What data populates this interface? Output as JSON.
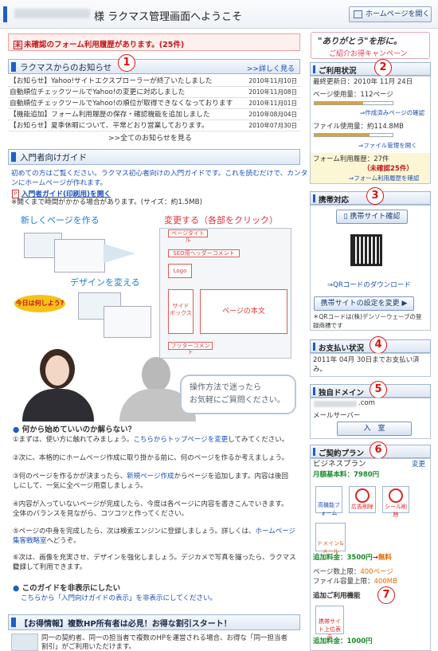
{
  "header": {
    "title": "様 ラクマス管理画面へようこそ",
    "home_button": "ホームページを開く"
  },
  "notice": {
    "mark": "未",
    "text": "未確認のフォーム利用履歴があります。(25件)"
  },
  "news": {
    "title": "ラクマスからのお知らせ",
    "more": ">>詳しく見る",
    "badge": "1",
    "items": [
      {
        "text": "【お知らせ】Yahoo!サイトエクスプローラーが終了いたしました",
        "date": "2010年11月10日"
      },
      {
        "text": "自動順位チェックツールでYahoo!の変更に対応しました",
        "date": "2010年11月08日"
      },
      {
        "text": "自動順位チェックツールでYahoo!の順位が取得できなくなっております",
        "date": "2010年11月01日"
      },
      {
        "text": "【機能追加】フォーム利用履歴の保存・確認機能を追加しました",
        "date": "2010年08月04日"
      },
      {
        "text": "【お知らせ】夏季休暇について、平常どおり営業しております。",
        "date": "2010年07月30日"
      }
    ],
    "all_link": ">>全てのお知らせを見る"
  },
  "guide": {
    "title": "入門者向けガイド",
    "intro1": "初めての方はご覧ください。ラクマス初心者向けの入門ガイドです。これを読むだけで、カンタ",
    "intro2": "ンにホームページが作れます。",
    "pdf_link": "入門者ガイド(印刷用)を開く",
    "pdf_note": "※開くまで時間がかかる場合があります。(サイズ：約1.5MB)",
    "illust": {
      "new_page": "新しくページを作る",
      "change": "変更する（各部をクリック）",
      "design": "デザインを変える",
      "today": "今日は何しよう?",
      "page_title": "ページタイトル",
      "seo_header": "SEO用ヘッダーコメント",
      "logo": "Logo",
      "sidebox": "サイド\nボックス",
      "body": "ページの本文",
      "footer": "フッターコメント",
      "balloon1": "操作方法で迷ったら",
      "balloon2": "お気軽にご質問ください。"
    },
    "steps_title": "何から始めていいのか解らない？",
    "step1a": "①まずは、使い方に触れてみましょう。",
    "step1b": "こちらからトップページを変更",
    "step1c": "してみてください。",
    "step2": "②次に、本格的にホームページ作成に取り掛かる前に、何のページを作るか考えましょう。",
    "step3a": "③何のページを作るかが決まったら、",
    "step3b": "新規ページ作成",
    "step3c": "からページを追加します。内容は後回",
    "step3d": "しにして、一気に全ページ用意しましょう。",
    "step4a": "④内容が入っていないページが完成したら、今度は各ページに内容を書きこんでいきます。",
    "step4b": "全体のバランスを見ながら、コツコツと作ってください。",
    "step5a": "⑤ページの中身を完成したら、次は検索エンジンに登録しましょう。詳しくは、",
    "step5b": "ホームページ",
    "step5c": "集客戦略室",
    "step5d": "へどうぞ。",
    "step6a": "⑥次は、画像を充実させ、デザインを強化しましょう。デジカメで写真を撮ったら、ラクマスに",
    "step6b": "登録して利用できます。",
    "hide_title": "このガイドを非表示にしたい",
    "hide_link": "こちらから「入門向けガイドの表示」を非表示にしてください。"
  },
  "deal": {
    "title": "【お得情報】複数HP所有者は必見！お得な割引スタート！",
    "text1": "同一の契約者、同一の担当者で複数のHPを運営される場合、お得な「同一担当者",
    "text2": "割引」がご利用いただけます。"
  },
  "right": {
    "thanks1": "\"ありがとう\"を形に。",
    "thanks2": "ご紹介お得キャンペーン",
    "usage": {
      "title": "ご利用状況",
      "badge": "2",
      "updated": "最終更新日：2010年 11月 24日",
      "page_usage": "ページ使用量：112ページ",
      "page_percent": 0.62,
      "page_link": "⇒作成済みページの確認",
      "file_usage": "ファイル使用量：約114.8MB",
      "file_percent": 0.7,
      "file_link": "⇒ファイル管理を開く",
      "form_usage": "フォーム利用履歴：27件",
      "form_unconfirmed": "（未確認25件）",
      "form_link": "⇒フォーム利用履歴を確認"
    },
    "mobile": {
      "title": "携帯対応",
      "badge": "3",
      "check_button": "携帯サイト確認",
      "qr_link": "⇒QRコードのダウンロード",
      "setting_button": "携帯サイトの設定を変更",
      "note1": "＊QRコードは(株)デンソーウェーブの登",
      "note2": "録商標です"
    },
    "payment": {
      "title": "お支払い状況",
      "badge": "4",
      "text1": "2011年 04月 30日までお支払い済",
      "text2": "み。"
    },
    "domain": {
      "title": "独自ドメイン",
      "badge": "5",
      "value": ".com",
      "mail_label": "メールサーバー",
      "mail_button": "入　室"
    },
    "plan": {
      "title": "ご契約プラン",
      "badge": "6",
      "name": "ビジネスプラン",
      "change": "変更",
      "fee": "月額基本料：7980円",
      "icons": [
        "高機能フォーム",
        "広告削除",
        "シール削除"
      ],
      "domain_mail": "ドメイン&メール",
      "add_fee_label": "追加料金：",
      "add_fee_old": "3500円",
      "add_fee_arrow": "→",
      "add_fee_new": "無料",
      "page_limit_label": "ページ数上限：",
      "page_limit": "400ページ",
      "file_limit_label": "ファイル容量上限：",
      "file_limit": "400MB",
      "extra_title": "追加ご利用機能",
      "badge7": "7",
      "extra_icon": "携帯サイト上位表示",
      "extra_fee": "追加料金：1000円"
    }
  }
}
